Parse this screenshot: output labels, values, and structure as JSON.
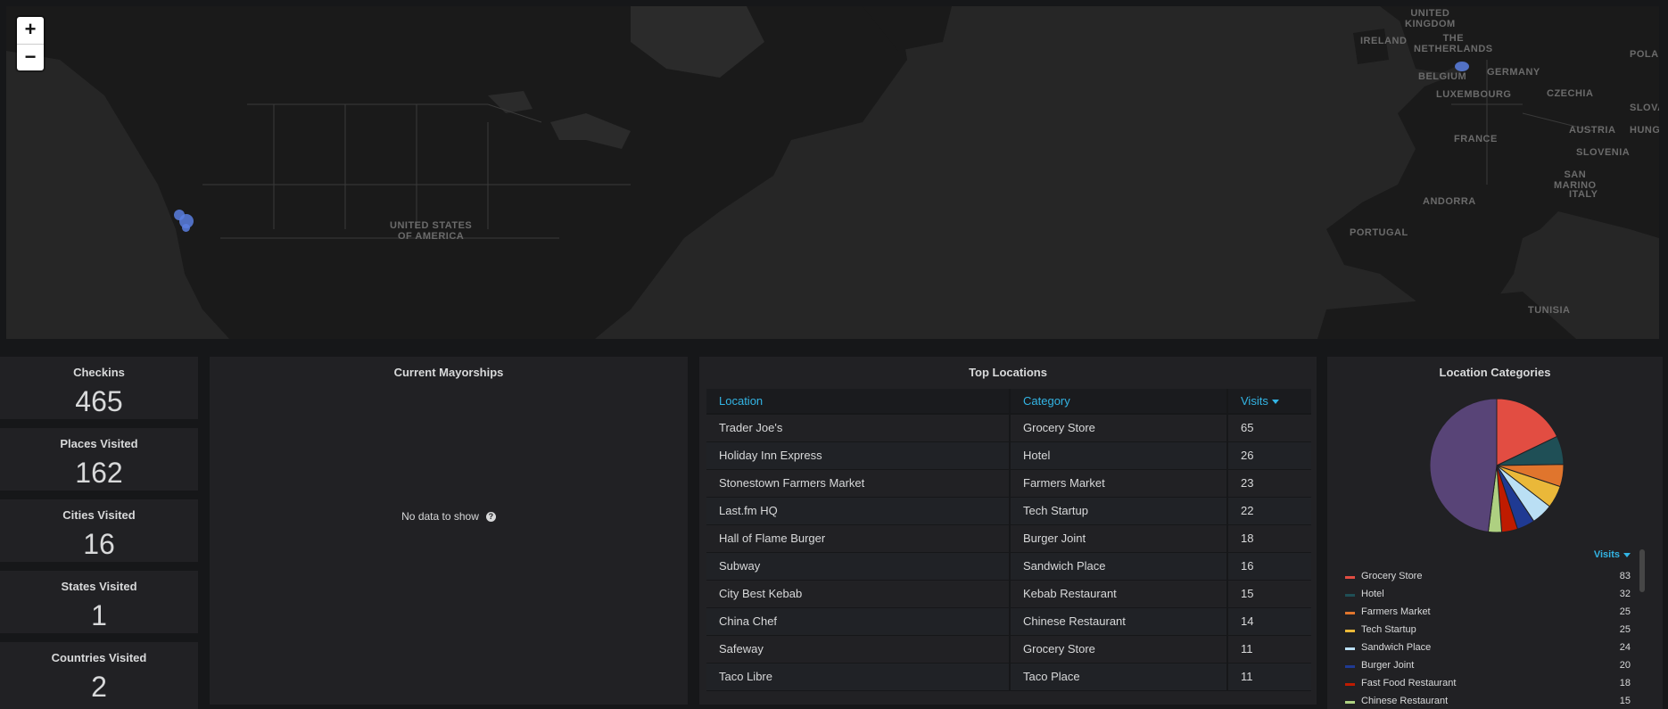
{
  "map": {
    "zoom_in": "+",
    "zoom_out": "−",
    "labels": [
      {
        "text": "UNITED\nKINGDOM"
      },
      {
        "text": "IRELAND"
      },
      {
        "text": "THE\nNETHERLANDS"
      },
      {
        "text": "BELGIUM"
      },
      {
        "text": "GERMANY"
      },
      {
        "text": "LUXEMBOURG"
      },
      {
        "text": "CZECHIA"
      },
      {
        "text": "POLAN"
      },
      {
        "text": "SLOVA"
      },
      {
        "text": "AUSTRIA"
      },
      {
        "text": "HUNG"
      },
      {
        "text": "FRANCE"
      },
      {
        "text": "SLOVENIA"
      },
      {
        "text": "SAN\nMARINO"
      },
      {
        "text": "ITALY"
      },
      {
        "text": "ANDORRA"
      },
      {
        "text": "PORTUGAL"
      },
      {
        "text": "TUNISIA"
      },
      {
        "text": "UNITED STATES\nOF AMERICA"
      }
    ],
    "marker_color": "#5b7fe0"
  },
  "stats": [
    {
      "title": "Checkins",
      "value": "465"
    },
    {
      "title": "Places Visited",
      "value": "162"
    },
    {
      "title": "Cities Visited",
      "value": "16"
    },
    {
      "title": "States Visited",
      "value": "1"
    },
    {
      "title": "Countries Visited",
      "value": "2"
    }
  ],
  "mayorships": {
    "title": "Current Mayorships",
    "empty": "No data to show",
    "help_glyph": "?"
  },
  "top_locations": {
    "title": "Top Locations",
    "headers": [
      "Location",
      "Category",
      "Visits"
    ],
    "rows": [
      [
        "Trader Joe's",
        "Grocery Store",
        "65"
      ],
      [
        "Holiday Inn Express",
        "Hotel",
        "26"
      ],
      [
        "Stonestown Farmers Market",
        "Farmers Market",
        "23"
      ],
      [
        "Last.fm HQ",
        "Tech Startup",
        "22"
      ],
      [
        "Hall of Flame Burger",
        "Burger Joint",
        "18"
      ],
      [
        "Subway",
        "Sandwich Place",
        "16"
      ],
      [
        "City Best Kebab",
        "Kebab Restaurant",
        "15"
      ],
      [
        "China Chef",
        "Chinese Restaurant",
        "14"
      ],
      [
        "Safeway",
        "Grocery Store",
        "11"
      ],
      [
        "Taco Libre",
        "Taco Place",
        "11"
      ]
    ]
  },
  "categories": {
    "title": "Location Categories",
    "legend_header": "Visits",
    "items": [
      {
        "name": "Grocery Store",
        "value": 83,
        "color": "#e24d42"
      },
      {
        "name": "Hotel",
        "value": 32,
        "color": "#1f4f56"
      },
      {
        "name": "Farmers Market",
        "value": 25,
        "color": "#e0752d"
      },
      {
        "name": "Tech Startup",
        "value": 25,
        "color": "#eab839"
      },
      {
        "name": "Sandwich Place",
        "value": 24,
        "color": "#badff4"
      },
      {
        "name": "Burger Joint",
        "value": 20,
        "color": "#1f3a93"
      },
      {
        "name": "Fast Food Restaurant",
        "value": 18,
        "color": "#bf1b00"
      },
      {
        "name": "Chinese Restaurant",
        "value": 15,
        "color": "#aed081"
      }
    ]
  }
}
